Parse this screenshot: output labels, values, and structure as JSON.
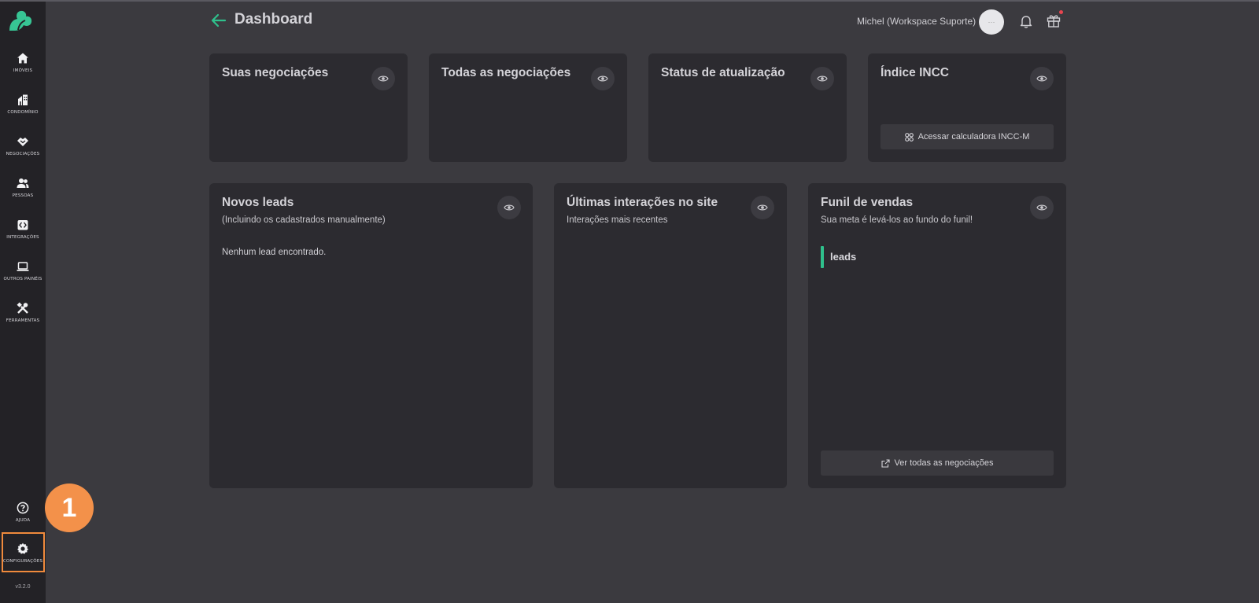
{
  "sidebar": {
    "items": [
      {
        "label": "IMÓVEIS",
        "icon": "home-icon"
      },
      {
        "label": "CONDOMÍNIO",
        "icon": "building-icon"
      },
      {
        "label": "NEGOCIAÇÕES",
        "icon": "handshake-icon"
      },
      {
        "label": "PESSOAS",
        "icon": "people-icon"
      },
      {
        "label": "INTEGRAÇÕES",
        "icon": "integration-icon"
      },
      {
        "label": "OUTROS PAINÉIS",
        "icon": "laptop-icon"
      },
      {
        "label": "FERRAMENTAS",
        "icon": "tools-icon"
      }
    ],
    "help_label": "AJUDA",
    "settings_label": "CONFIGURAÇÕES",
    "version": "v3.2.0"
  },
  "annotation": {
    "marker_number": "1",
    "highlight_color": "#f08a3c"
  },
  "header": {
    "title": "Dashboard",
    "user_name": "Michel (Workspace Suporte)",
    "avatar_text": "···"
  },
  "cards": {
    "suas_negociacoes": {
      "title": "Suas negociações"
    },
    "todas_negociacoes": {
      "title": "Todas as negociações"
    },
    "status_atualizacao": {
      "title": "Status de atualização"
    },
    "indice_incc": {
      "title": "Índice INCC",
      "button_label": "Acessar calculadora INCC-M"
    },
    "novos_leads": {
      "title": "Novos leads",
      "subtitle": "(Incluindo os cadastrados manualmente)",
      "empty_text": "Nenhum lead encontrado."
    },
    "ultimas_interacoes": {
      "title": "Últimas interações no site",
      "subtitle": "Interações mais recentes"
    },
    "funil_vendas": {
      "title": "Funil de vendas",
      "subtitle": "Sua meta é levá-los ao fundo do funil!",
      "stage_label": "leads",
      "button_label": "Ver todas as negociações"
    }
  },
  "colors": {
    "background": "#3b3a3f",
    "sidebar": "#232226",
    "card": "#2c2b30",
    "accent_green": "#2fc08c",
    "notification_dot": "#e8454f",
    "marker_orange": "#f3914a"
  }
}
